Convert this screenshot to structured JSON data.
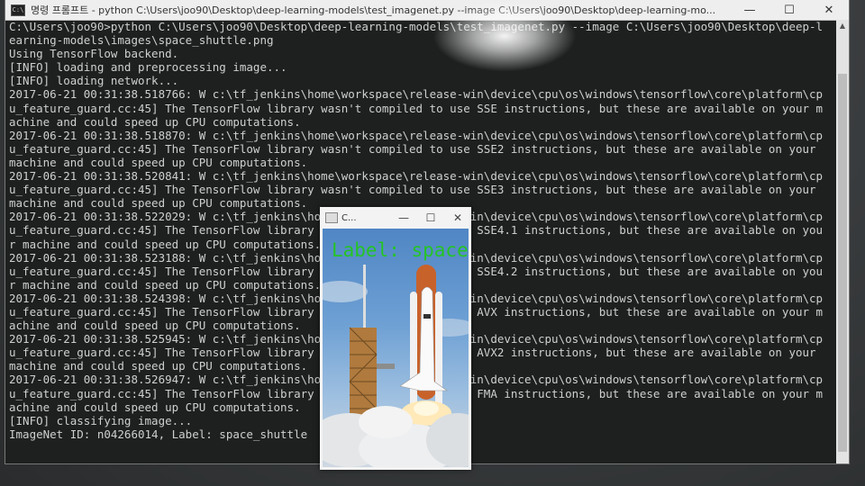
{
  "console": {
    "title": "명령 프롬프트 - python  C:\\Users\\joo90\\Desktop\\deep-learning-models\\test_imagenet.py --image C:\\Users\\joo90\\Desktop\\deep-learning-mo...",
    "controls": {
      "minimize": "—",
      "maximize": "☐",
      "close": "✕"
    },
    "lines": [
      "C:\\Users\\joo90>python C:\\Users\\joo90\\Desktop\\deep-learning-models\\test_imagenet.py --image C:\\Users\\joo90\\Desktop\\deep-l",
      "earning-models\\images\\space_shuttle.png",
      "Using TensorFlow backend.",
      "[INFO] loading and preprocessing image...",
      "[INFO] loading network...",
      "2017-06-21 00:31:38.518766: W c:\\tf_jenkins\\home\\workspace\\release-win\\device\\cpu\\os\\windows\\tensorflow\\core\\platform\\cp",
      "u_feature_guard.cc:45] The TensorFlow library wasn't compiled to use SSE instructions, but these are available on your m",
      "achine and could speed up CPU computations.",
      "2017-06-21 00:31:38.518870: W c:\\tf_jenkins\\home\\workspace\\release-win\\device\\cpu\\os\\windows\\tensorflow\\core\\platform\\cp",
      "u_feature_guard.cc:45] The TensorFlow library wasn't compiled to use SSE2 instructions, but these are available on your",
      "machine and could speed up CPU computations.",
      "2017-06-21 00:31:38.520841: W c:\\tf_jenkins\\home\\workspace\\release-win\\device\\cpu\\os\\windows\\tensorflow\\core\\platform\\cp",
      "u_feature_guard.cc:45] The TensorFlow library wasn't compiled to use SSE3 instructions, but these are available on your",
      "machine and could speed up CPU computations.",
      "2017-06-21 00:31:38.522029: W c:\\tf_jenkins\\home\\workspace\\release-win\\device\\cpu\\os\\windows\\tensorflow\\core\\platform\\cp",
      "u_feature_guard.cc:45] The TensorFlow library wasn't compiled to use SSE4.1 instructions, but these are available on you",
      "r machine and could speed up CPU computations.",
      "2017-06-21 00:31:38.523188: W c:\\tf_jenkins\\home\\workspace\\release-win\\device\\cpu\\os\\windows\\tensorflow\\core\\platform\\cp",
      "u_feature_guard.cc:45] The TensorFlow library wasn't compiled to use SSE4.2 instructions, but these are available on you",
      "r machine and could speed up CPU computations.",
      "2017-06-21 00:31:38.524398: W c:\\tf_jenkins\\home\\workspace\\release-win\\device\\cpu\\os\\windows\\tensorflow\\core\\platform\\cp",
      "u_feature_guard.cc:45] The TensorFlow library wasn't compiled to use AVX instructions, but these are available on your m",
      "achine and could speed up CPU computations.",
      "2017-06-21 00:31:38.525945: W c:\\tf_jenkins\\home\\workspace\\release-win\\device\\cpu\\os\\windows\\tensorflow\\core\\platform\\cp",
      "u_feature_guard.cc:45] The TensorFlow library wasn't compiled to use AVX2 instructions, but these are available on your",
      "machine and could speed up CPU computations.",
      "2017-06-21 00:31:38.526947: W c:\\tf_jenkins\\home\\workspace\\release-win\\device\\cpu\\os\\windows\\tensorflow\\core\\platform\\cp",
      "u_feature_guard.cc:45] The TensorFlow library wasn't compiled to use FMA instructions, but these are available on your m",
      "achine and could speed up CPU computations.",
      "[INFO] classifying image...",
      "ImageNet ID: n04266014, Label: space_shuttle"
    ]
  },
  "image_window": {
    "title": "C...",
    "controls": {
      "minimize": "—",
      "maximize": "☐",
      "close": "✕"
    },
    "overlay_label": "Label: space",
    "overlay_color": "#25c425"
  },
  "colors": {
    "console_bg": "#1e2020",
    "console_text": "#cfcfcf"
  }
}
